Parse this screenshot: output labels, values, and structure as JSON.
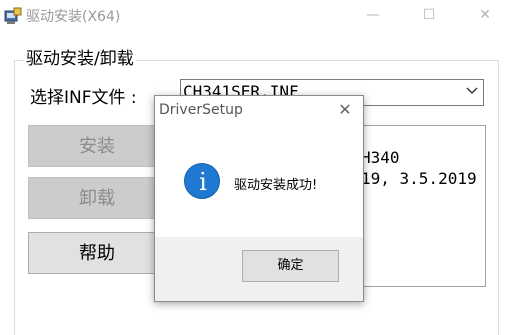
{
  "window": {
    "title": "驱动安装(X64)",
    "minimize": "—",
    "maximize": "☐",
    "close": "✕"
  },
  "group": {
    "title": "驱动安装/卸载",
    "inf_label": "选择INF文件 :",
    "inf_value": "CH341SER.INF",
    "buttons": {
      "install": "安装",
      "uninstall": "卸载",
      "help": "帮助"
    },
    "info_lines": [
      "H340",
      "19, 3.5.2019"
    ]
  },
  "dialog": {
    "title": "DriverSetup",
    "close": "✕",
    "message": "驱动安装成功!",
    "ok": "确定",
    "icon": "info-icon",
    "icon_glyph": "i"
  },
  "colors": {
    "info_icon": "#1f78d1",
    "dialog_footer": "#f0f0f0",
    "disabled_button": "#cccccc"
  }
}
